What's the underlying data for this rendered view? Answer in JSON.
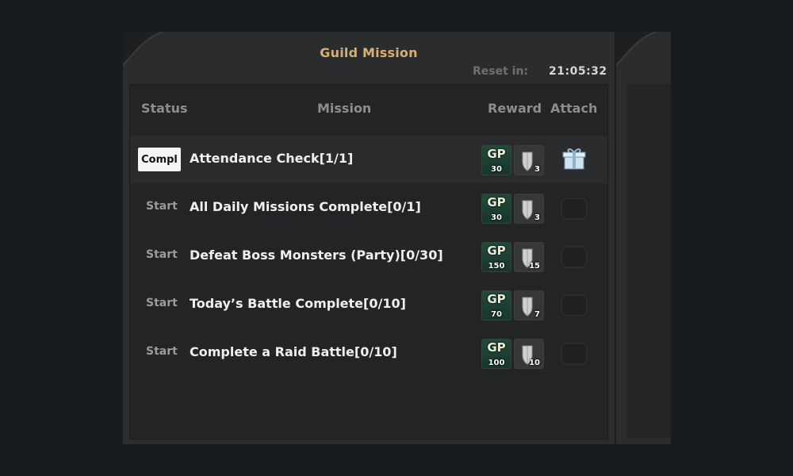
{
  "window": {
    "title": "Guild Mission",
    "reset_label": "Reset in:",
    "reset_time": "21:05:32"
  },
  "columns": {
    "status": "Status",
    "mission": "Mission",
    "reward": "Reward",
    "attach": "Attach"
  },
  "missions": [
    {
      "status": "Compl",
      "status_state": "complete",
      "name": "Attendance Check[1/1]",
      "reward_gp_label": "GP",
      "reward_gp": "30",
      "reward_shield": "3",
      "attach_icon": "gift-box-icon",
      "highlighted": true
    },
    {
      "status": "Start",
      "status_state": "start",
      "name": "All Daily Missions Complete[0/1]",
      "reward_gp_label": "GP",
      "reward_gp": "30",
      "reward_shield": "3",
      "attach_icon": "empty-slot-icon"
    },
    {
      "status": "Start",
      "status_state": "start",
      "name": "Defeat Boss Monsters (Party)[0/30]",
      "reward_gp_label": "GP",
      "reward_gp": "150",
      "reward_shield": "15",
      "attach_icon": "empty-slot-icon"
    },
    {
      "status": "Start",
      "status_state": "start",
      "name": "Today’s Battle Complete[0/10]",
      "reward_gp_label": "GP",
      "reward_gp": "70",
      "reward_shield": "7",
      "attach_icon": "empty-slot-icon"
    },
    {
      "status": "Start",
      "status_state": "start",
      "name": "Complete a Raid Battle[0/10]",
      "reward_gp_label": "GP",
      "reward_gp": "100",
      "reward_shield": "10",
      "attach_icon": "empty-slot-icon"
    }
  ],
  "colors": {
    "background": "#181b1f",
    "panel": "#2b2c2d",
    "title": "#d7ae74",
    "gp_badge": "#214a3a"
  }
}
